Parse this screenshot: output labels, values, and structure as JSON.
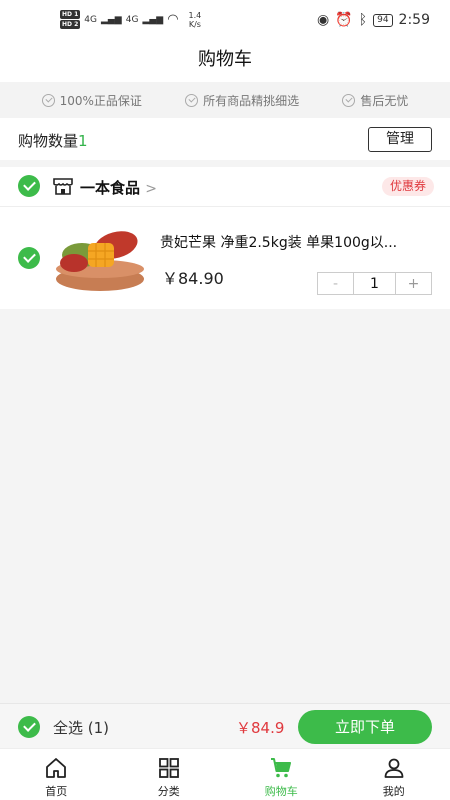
{
  "status_bar": {
    "hd1": "HD 1",
    "hd2": "HD 2",
    "signal1": "4G",
    "signal2": "4G",
    "net_speed": "1.4",
    "net_unit": "K/s",
    "battery": "94",
    "time": "2:59"
  },
  "header": {
    "title": "购物车"
  },
  "guarantees": [
    "100%正品保证",
    "所有商品精挑细选",
    "售后无忧"
  ],
  "cart_count": {
    "label": "购物数量",
    "count": "1",
    "manage_label": "管理"
  },
  "store": {
    "name": "一本食品",
    "arrow": ">",
    "coupon_label": "优惠券",
    "item": {
      "title": "贵妃芒果 净重2.5kg装 单果100g以...",
      "price": "￥84.90",
      "quantity": "1",
      "minus": "-",
      "plus": "+"
    }
  },
  "checkout": {
    "select_all_label": "全选 (1)",
    "total": "￥84.9",
    "order_label": "立即下单"
  },
  "tabs": [
    {
      "label": "首页",
      "icon": "home-icon"
    },
    {
      "label": "分类",
      "icon": "category-icon"
    },
    {
      "label": "购物车",
      "icon": "cart-icon",
      "active": true
    },
    {
      "label": "我的",
      "icon": "user-icon"
    }
  ],
  "colors": {
    "accent": "#3dbb4a",
    "price_red": "#e0393e"
  }
}
